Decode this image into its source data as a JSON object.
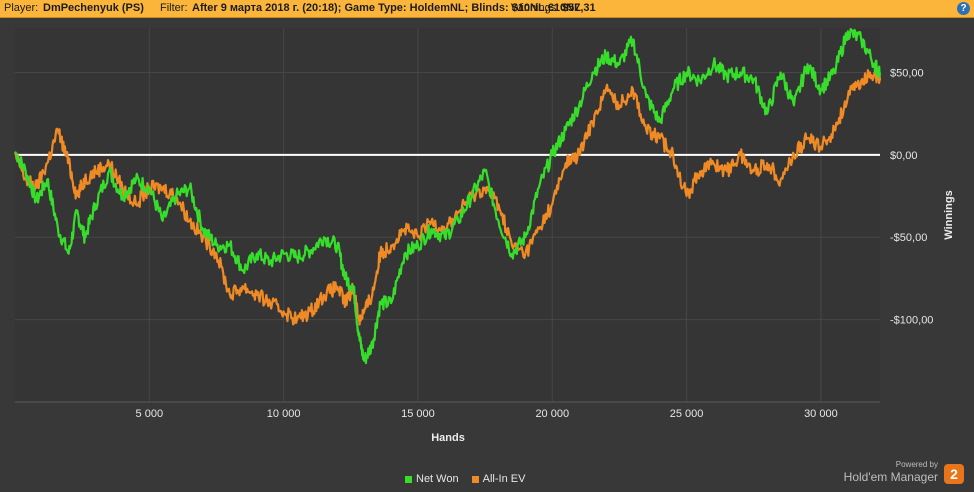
{
  "header": {
    "player_label": "Player:",
    "player": "DmPechenyuk (PS)",
    "filter_label": "Filter:",
    "filter": "After 9 марта 2018 г. (20:18); Game Type: HoldemNL; Blinds: $10NL,€10NL",
    "winnings_label": "Winnings:",
    "winnings": "$57,31",
    "help_icon": "?"
  },
  "chart_data": {
    "type": "line",
    "xlabel": "Hands",
    "ylabel": "Winnings",
    "xlim": [
      0,
      32200
    ],
    "ylim": [
      -150,
      77
    ],
    "x_ticks": [
      5000,
      10000,
      15000,
      20000,
      25000,
      30000
    ],
    "x_tick_labels": [
      "5 000",
      "10 000",
      "15 000",
      "20 000",
      "25 000",
      "30 000"
    ],
    "y_ticks": [
      50,
      0,
      -50,
      -100
    ],
    "y_tick_labels": [
      "$50,00",
      "$0,00",
      "-$50,00",
      "-$100,00"
    ],
    "zero_line": true,
    "grid": true,
    "legend_position": "bottom",
    "series": [
      {
        "name": "Net Won",
        "color": "#37dd2b",
        "x": [
          0,
          400,
          800,
          1200,
          1600,
          2000,
          2300,
          2600,
          3000,
          3500,
          4000,
          4500,
          5000,
          5500,
          6000,
          6500,
          7000,
          7500,
          8000,
          8500,
          9000,
          9500,
          10000,
          10500,
          11000,
          11500,
          12000,
          12300,
          12600,
          12800,
          13000,
          13300,
          13600,
          14000,
          14500,
          15000,
          15500,
          16000,
          16500,
          17000,
          17500,
          18000,
          18500,
          19000,
          19500,
          20000,
          20500,
          21000,
          21500,
          22000,
          22500,
          23000,
          23500,
          24000,
          24500,
          25000,
          25500,
          26000,
          26500,
          27000,
          27500,
          28000,
          28500,
          29000,
          29500,
          30000,
          30500,
          31000,
          31500,
          32000,
          32200
        ],
        "y": [
          2,
          -10,
          -28,
          -15,
          -45,
          -60,
          -35,
          -50,
          -30,
          -10,
          -25,
          -15,
          -20,
          -40,
          -25,
          -20,
          -45,
          -55,
          -55,
          -70,
          -60,
          -65,
          -60,
          -62,
          -58,
          -50,
          -55,
          -75,
          -80,
          -110,
          -125,
          -115,
          -90,
          -90,
          -60,
          -55,
          -45,
          -50,
          -40,
          -25,
          -10,
          -40,
          -60,
          -50,
          -20,
          0,
          15,
          30,
          50,
          60,
          55,
          70,
          35,
          20,
          40,
          50,
          45,
          55,
          48,
          50,
          46,
          25,
          50,
          30,
          55,
          40,
          50,
          75,
          70,
          55,
          50
        ]
      },
      {
        "name": "All-In EV",
        "color": "#f08a24",
        "x": [
          0,
          400,
          800,
          1200,
          1600,
          2000,
          2300,
          2600,
          3000,
          3500,
          4000,
          4500,
          5000,
          5500,
          6000,
          6500,
          7000,
          7500,
          8000,
          8500,
          9000,
          9500,
          10000,
          10500,
          11000,
          11500,
          12000,
          12300,
          12600,
          12800,
          13000,
          13300,
          13600,
          14000,
          14500,
          15000,
          15500,
          16000,
          16500,
          17000,
          17500,
          18000,
          18500,
          19000,
          19500,
          20000,
          20500,
          21000,
          21500,
          22000,
          22500,
          23000,
          23500,
          24000,
          24500,
          25000,
          25500,
          26000,
          26500,
          27000,
          27500,
          28000,
          28500,
          29000,
          29500,
          30000,
          30500,
          31000,
          31500,
          32000,
          32200
        ],
        "y": [
          0,
          -15,
          -20,
          -5,
          15,
          -5,
          -25,
          -15,
          -10,
          -5,
          -20,
          -30,
          -20,
          -20,
          -25,
          -40,
          -50,
          -60,
          -85,
          -80,
          -85,
          -90,
          -95,
          -100,
          -95,
          -85,
          -80,
          -90,
          -80,
          -100,
          -95,
          -85,
          -60,
          -55,
          -45,
          -50,
          -40,
          -45,
          -35,
          -25,
          -20,
          -30,
          -55,
          -60,
          -45,
          -30,
          -5,
          0,
          20,
          40,
          30,
          40,
          15,
          10,
          0,
          -25,
          -10,
          -5,
          -10,
          0,
          -10,
          -5,
          -15,
          0,
          10,
          5,
          15,
          35,
          45,
          50,
          45
        ]
      }
    ]
  },
  "legend": {
    "items": [
      "Net Won",
      "All-In EV"
    ]
  },
  "branding": {
    "powered_by": "Powered by",
    "product": "Hold'em Manager",
    "logo_glyph": "2"
  }
}
